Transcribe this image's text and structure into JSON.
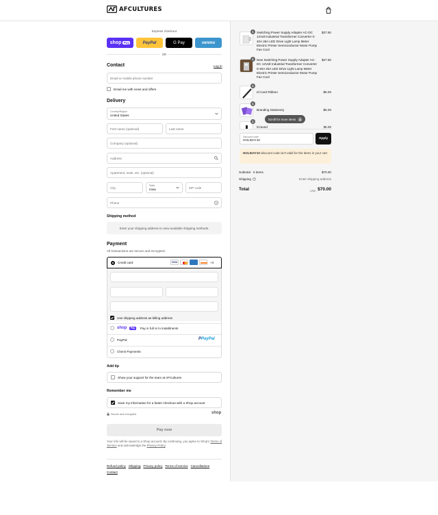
{
  "header": {
    "brand": "AFCULTURES",
    "cart_icon": "shopping-bag-icon"
  },
  "express": {
    "title": "Express checkout",
    "buttons": [
      {
        "label": "shop",
        "sub": "Pay",
        "color": "#5a31f4"
      },
      {
        "label": "PayPal",
        "color": "#ffc439"
      },
      {
        "label": "G Pay",
        "color": "#000000"
      },
      {
        "label": "venmo",
        "color": "#3d95ce"
      }
    ],
    "or": "OR"
  },
  "contact": {
    "title": "Contact",
    "login": "Log in",
    "email_placeholder": "Email or mobile phone number",
    "news_label": "Email me with news and offers"
  },
  "delivery": {
    "title": "Delivery",
    "country_label": "Country/Region",
    "country_value": "United States",
    "first_name": "First name (optional)",
    "last_name": "Last name",
    "company": "Company (optional)",
    "address": "Address",
    "apartment": "Apartment, suite, etc. (optional)",
    "city": "City",
    "state_label": "State",
    "state_value": "Iowa",
    "zip": "ZIP code",
    "phone": "Phone"
  },
  "shipping_method": {
    "title": "Shipping method",
    "note": "Enter your shipping address to view available shipping methods."
  },
  "payment": {
    "title": "Payment",
    "subtitle": "All transactions are secure and encrypted.",
    "credit_card": "Credit card",
    "more_cards": "+4",
    "billing_label": "Use shipping address as billing address",
    "shoppay_label": "Pay in full or in installments",
    "paypal": "PayPal",
    "checks": "Check Payments"
  },
  "tip": {
    "title": "Add tip",
    "label": "Show your support for the team at AFCultures"
  },
  "remember": {
    "title": "Remember me",
    "label": "Save my information for a faster checkout with a Shop account",
    "secure": "Secure and encrypted",
    "shop": "shop"
  },
  "pay_now": "Pay now",
  "legal": {
    "line1": "Your info will be saved to a Shop account. By continuing, you agree to Shop's",
    "terms": "Terms of Service",
    "and": " and acknowledge the ",
    "privacy": "Privacy Policy",
    "end": "."
  },
  "footer_links": [
    "Refund policy",
    "Shipping",
    "Privacy policy",
    "Terms of service",
    "Cancellations",
    "Contact"
  ],
  "cart": {
    "items": [
      {
        "qty": "1",
        "name": "Switching Power Supply Adapter AC-DC 12Volt Industrial Transformer Converter 0-40A 25A LED Drive Light Lamp Meter Electric Printer Semiconductor Motor Pump Fan Cool",
        "price": "$27.50"
      },
      {
        "qty": "1",
        "name": "New Switching Power Supply Adapter AC-DC 12Volt Industrial Transformer Converter 0-40A 25A LED Drive Light Lamp Meter Electric Printer Semiconductor Motor Pump Fan Cool",
        "price": "$27.50"
      },
      {
        "qty": "1",
        "name": "Id Card Ribbon",
        "price": "$5.00"
      },
      {
        "qty": "1",
        "name": "Branding Stationery",
        "price": "$5.00"
      },
      {
        "qty": "1",
        "name": "iCraved",
        "price": "$5.00"
      }
    ],
    "scroll_hint": "Scroll for more items",
    "discount_label": "Discount code",
    "discount_value": "HOLIDAY10",
    "apply": "Apply",
    "warning_code": "HOLIDAY10",
    "warning_text": " discount code isn't valid for the items in your cart",
    "subtotal_label": "Subtotal · 5 items",
    "subtotal_value": "$70.00",
    "shipping_label": "Shipping",
    "shipping_value": "Enter shipping address",
    "total_label": "Total",
    "currency": "USD",
    "total_value": "$70.00"
  }
}
